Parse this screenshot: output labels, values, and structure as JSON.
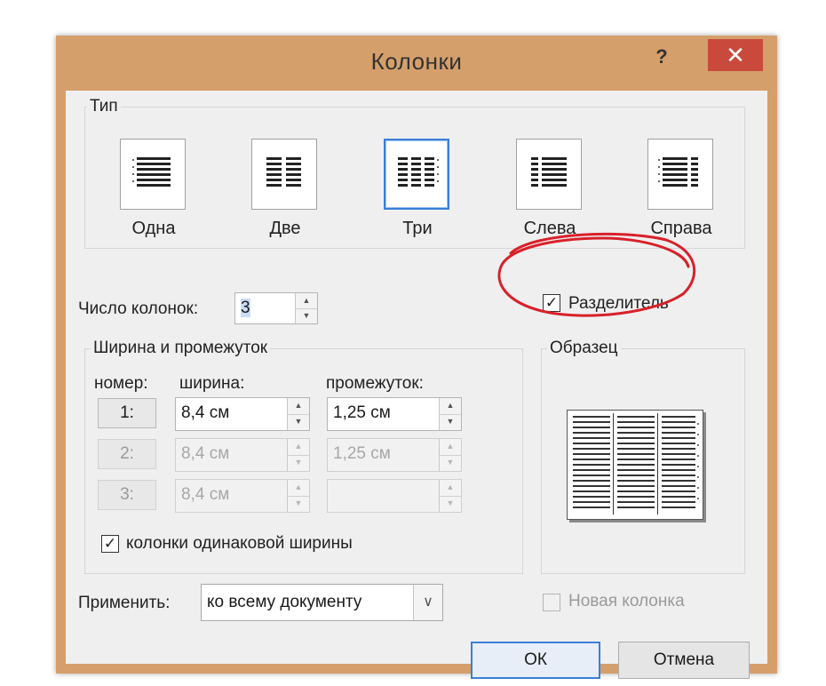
{
  "dialog": {
    "title": "Колонки",
    "help_label": "?",
    "close_label": "✕",
    "frame_color": "#d59f6b",
    "accent_color": "#3c7fd6",
    "close_color": "#c94a3c"
  },
  "type_group": {
    "label": "Тип",
    "presets": [
      {
        "label": "Одна",
        "icon": "one-column-icon",
        "selected": false
      },
      {
        "label": "Две",
        "icon": "two-columns-icon",
        "selected": false
      },
      {
        "label": "Три",
        "icon": "three-columns-icon",
        "selected": true
      },
      {
        "label": "Слева",
        "icon": "left-column-icon",
        "selected": false
      },
      {
        "label": "Справа",
        "icon": "right-column-icon",
        "selected": false
      }
    ]
  },
  "columns_count": {
    "label": "Число колонок:",
    "value": "3"
  },
  "separator": {
    "label": "Разделитель",
    "checked": true
  },
  "sample": {
    "label": "Образец"
  },
  "width_spacing": {
    "label": "Ширина и промежуток",
    "headers": {
      "number": "номер:",
      "width": "ширина:",
      "spacing": "промежуток:"
    },
    "rows": [
      {
        "number": "1:",
        "width": "8,4 см",
        "spacing": "1,25 см",
        "enabled": true
      },
      {
        "number": "2:",
        "width": "8,4 см",
        "spacing": "1,25 см",
        "enabled": false
      },
      {
        "number": "3:",
        "width": "8,4 см",
        "spacing": "",
        "enabled": false
      }
    ],
    "equal_width": {
      "label": "колонки одинаковой ширины",
      "checked": true
    }
  },
  "apply": {
    "label": "Применить:",
    "value": "ко всему документу"
  },
  "new_column": {
    "label": "Новая колонка",
    "checked": false
  },
  "buttons": {
    "ok": "ОК",
    "cancel": "Отмена"
  }
}
